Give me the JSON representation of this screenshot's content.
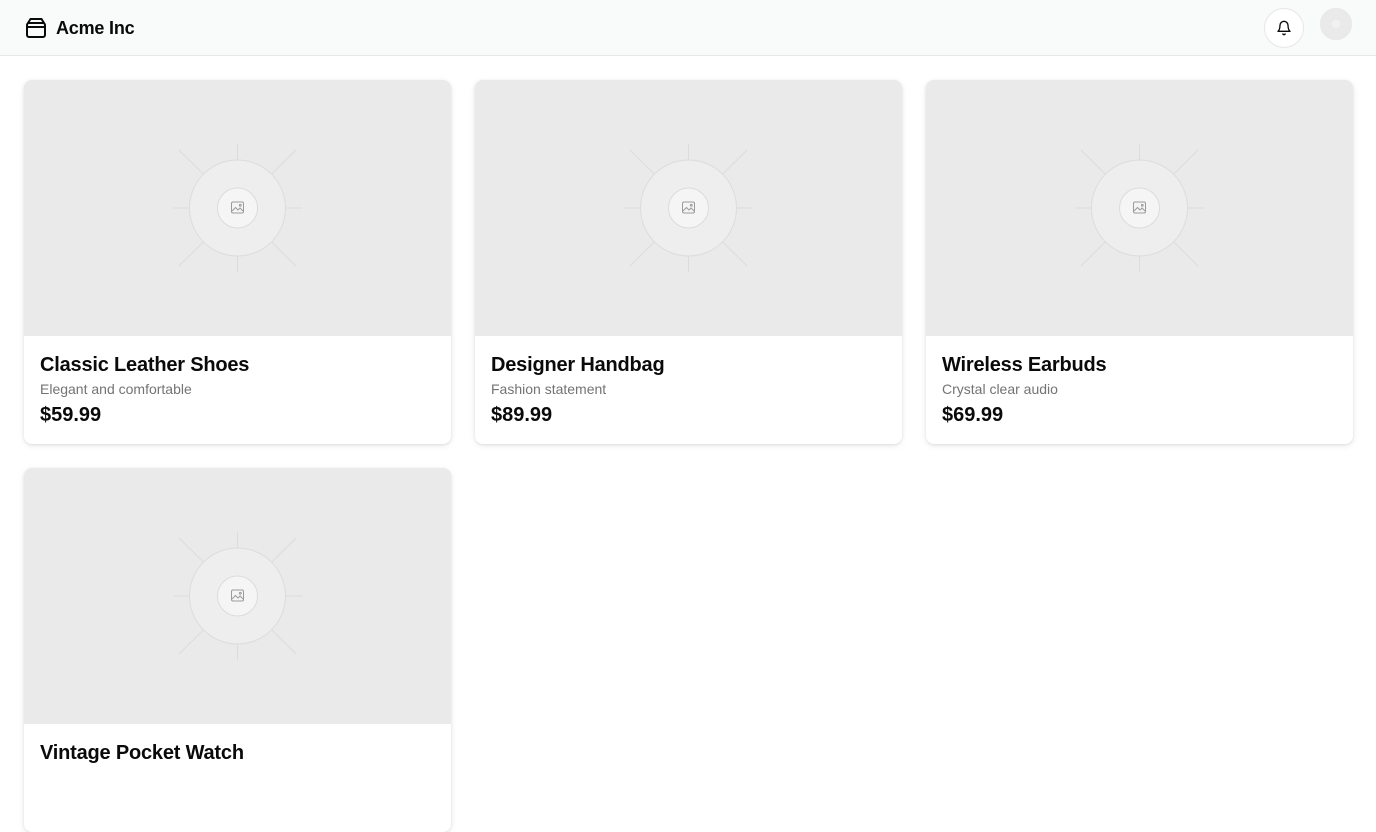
{
  "header": {
    "brand_name": "Acme Inc",
    "brand_icon": "package-icon",
    "notifications_icon": "bell-icon",
    "avatar_icon": "user-avatar"
  },
  "products": [
    {
      "title": "Classic Leather Shoes",
      "description": "Elegant and comfortable",
      "price": "$59.99",
      "image_icon": "image-placeholder-icon"
    },
    {
      "title": "Designer Handbag",
      "description": "Fashion statement",
      "price": "$89.99",
      "image_icon": "image-placeholder-icon"
    },
    {
      "title": "Wireless Earbuds",
      "description": "Crystal clear audio",
      "price": "$69.99",
      "image_icon": "image-placeholder-icon"
    },
    {
      "title": "Vintage Pocket Watch",
      "description": "",
      "price": "",
      "image_icon": "image-placeholder-icon"
    }
  ],
  "colors": {
    "header_bg": "#f9fafa",
    "placeholder_bg": "#eaeaea",
    "muted_text": "#737373",
    "text": "#0a0a0a"
  }
}
